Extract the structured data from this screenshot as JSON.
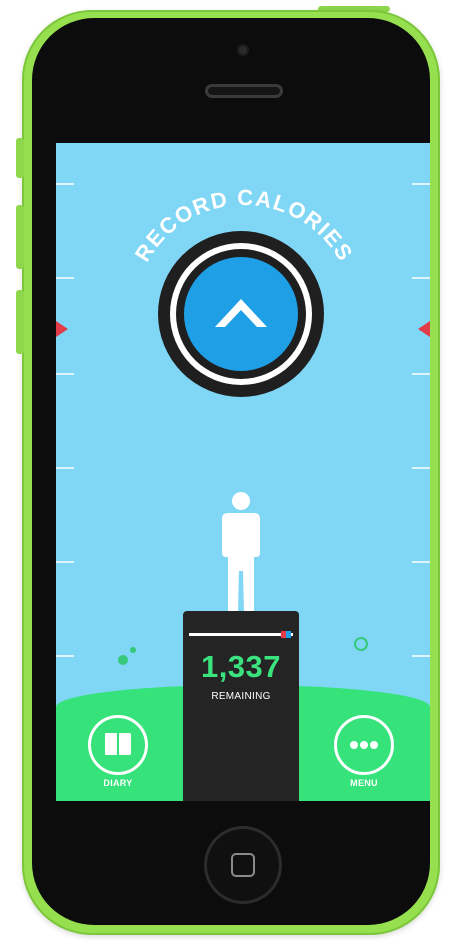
{
  "record": {
    "label": "RECORD CALORIES"
  },
  "calories": {
    "value": "1,337",
    "caption": "REMAINING"
  },
  "nav": {
    "diary_label": "DIARY",
    "menu_label": "MENU"
  },
  "icons": {
    "record": "chevron-up-icon",
    "person": "person-icon",
    "diary": "book-icon",
    "menu": "more-dots-icon"
  },
  "colors": {
    "sky": "#7fd6f5",
    "ground": "#36e27a",
    "record_button": "#1f9fe6",
    "count_text": "#3be37e",
    "marker": "#e23b4a",
    "phone_shell": "#96e04f"
  }
}
